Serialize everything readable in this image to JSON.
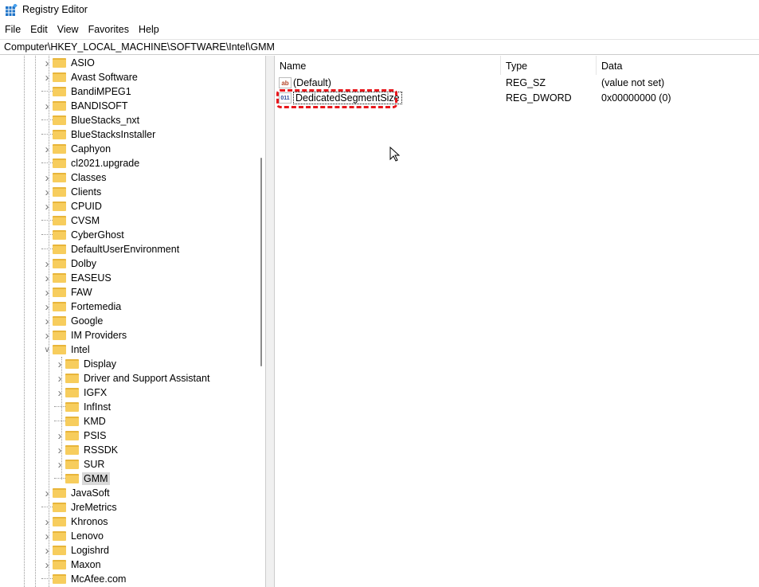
{
  "window": {
    "title": "Registry Editor"
  },
  "menu": [
    "File",
    "Edit",
    "View",
    "Favorites",
    "Help"
  ],
  "address": "Computer\\HKEY_LOCAL_MACHINE\\SOFTWARE\\Intel\\GMM",
  "tree": [
    {
      "label": "ASIO",
      "level": 1,
      "expander": "collapsed"
    },
    {
      "label": "Avast Software",
      "level": 1,
      "expander": "collapsed"
    },
    {
      "label": "BandiMPEG1",
      "level": 1,
      "expander": "none"
    },
    {
      "label": "BANDISOFT",
      "level": 1,
      "expander": "collapsed"
    },
    {
      "label": "BlueStacks_nxt",
      "level": 1,
      "expander": "none"
    },
    {
      "label": "BlueStacksInstaller",
      "level": 1,
      "expander": "none"
    },
    {
      "label": "Caphyon",
      "level": 1,
      "expander": "collapsed"
    },
    {
      "label": "cl2021.upgrade",
      "level": 1,
      "expander": "none"
    },
    {
      "label": "Classes",
      "level": 1,
      "expander": "collapsed"
    },
    {
      "label": "Clients",
      "level": 1,
      "expander": "collapsed"
    },
    {
      "label": "CPUID",
      "level": 1,
      "expander": "collapsed"
    },
    {
      "label": "CVSM",
      "level": 1,
      "expander": "none"
    },
    {
      "label": "CyberGhost",
      "level": 1,
      "expander": "none"
    },
    {
      "label": "DefaultUserEnvironment",
      "level": 1,
      "expander": "none"
    },
    {
      "label": "Dolby",
      "level": 1,
      "expander": "collapsed"
    },
    {
      "label": "EASEUS",
      "level": 1,
      "expander": "collapsed"
    },
    {
      "label": "FAW",
      "level": 1,
      "expander": "collapsed"
    },
    {
      "label": "Fortemedia",
      "level": 1,
      "expander": "collapsed"
    },
    {
      "label": "Google",
      "level": 1,
      "expander": "collapsed"
    },
    {
      "label": "IM Providers",
      "level": 1,
      "expander": "collapsed"
    },
    {
      "label": "Intel",
      "level": 1,
      "expander": "expanded"
    },
    {
      "label": "Display",
      "level": 2,
      "expander": "collapsed"
    },
    {
      "label": "Driver and Support Assistant",
      "level": 2,
      "expander": "collapsed"
    },
    {
      "label": "IGFX",
      "level": 2,
      "expander": "collapsed"
    },
    {
      "label": "InfInst",
      "level": 2,
      "expander": "none"
    },
    {
      "label": "KMD",
      "level": 2,
      "expander": "none"
    },
    {
      "label": "PSIS",
      "level": 2,
      "expander": "collapsed"
    },
    {
      "label": "RSSDK",
      "level": 2,
      "expander": "collapsed"
    },
    {
      "label": "SUR",
      "level": 2,
      "expander": "collapsed"
    },
    {
      "label": "GMM",
      "level": 2,
      "expander": "none",
      "selected": true
    },
    {
      "label": "JavaSoft",
      "level": 1,
      "expander": "collapsed"
    },
    {
      "label": "JreMetrics",
      "level": 1,
      "expander": "none"
    },
    {
      "label": "Khronos",
      "level": 1,
      "expander": "collapsed"
    },
    {
      "label": "Lenovo",
      "level": 1,
      "expander": "collapsed"
    },
    {
      "label": "Logishrd",
      "level": 1,
      "expander": "collapsed"
    },
    {
      "label": "Maxon",
      "level": 1,
      "expander": "collapsed"
    },
    {
      "label": "McAfee.com",
      "level": 1,
      "expander": "none"
    }
  ],
  "list": {
    "columns": [
      "Name",
      "Type",
      "Data"
    ],
    "rows": [
      {
        "icon": "string-value-icon",
        "icon_text": "ab",
        "name": "(Default)",
        "type": "REG_SZ",
        "data": "(value not set)"
      },
      {
        "icon": "binary-value-icon",
        "icon_text": "011",
        "name": "DedicatedSegmentSize",
        "type": "REG_DWORD",
        "data": "0x00000000 (0)"
      }
    ]
  },
  "colors": {
    "highlight": "#e8161b",
    "folder": "#f7cd5d",
    "selection": "#d9d9d9"
  }
}
